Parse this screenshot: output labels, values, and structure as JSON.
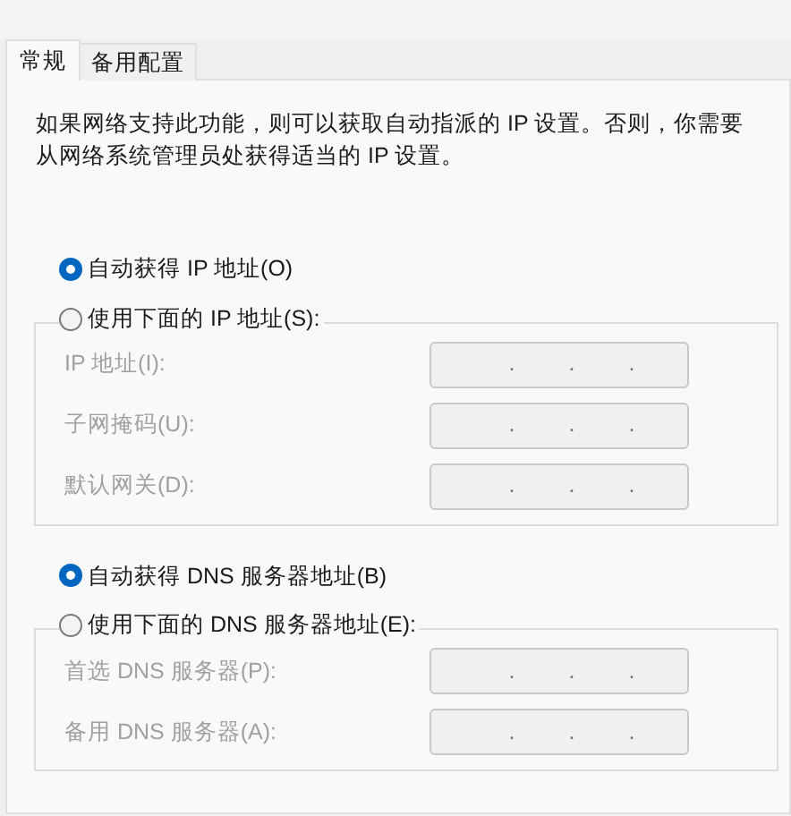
{
  "tabs": [
    {
      "label": "常规",
      "selected": true
    },
    {
      "label": "备用配置",
      "selected": false
    }
  ],
  "description": "如果网络支持此功能，则可以获取自动指派的 IP 设置。否则，你需要从网络系统管理员处获得适当的 IP 设置。",
  "sections": [
    {
      "auto_option": {
        "label": "自动获得 IP 地址(O)",
        "selected": true
      },
      "manual_option": {
        "label": "使用下面的 IP 地址(S):",
        "selected": false
      },
      "fields": [
        {
          "label": "IP 地址(I):",
          "separators": [
            ".",
            ".",
            "."
          ],
          "disabled": true
        },
        {
          "label": "子网掩码(U):",
          "separators": [
            ".",
            ".",
            "."
          ],
          "disabled": true
        },
        {
          "label": "默认网关(D):",
          "separators": [
            ".",
            ".",
            "."
          ],
          "disabled": true
        }
      ]
    },
    {
      "auto_option": {
        "label": "自动获得 DNS 服务器地址(B)",
        "selected": true
      },
      "manual_option": {
        "label": "使用下面的 DNS 服务器地址(E):",
        "selected": false
      },
      "fields": [
        {
          "label": "首选 DNS 服务器(P):",
          "separators": [
            ".",
            ".",
            "."
          ],
          "disabled": true
        },
        {
          "label": "备用 DNS 服务器(A):",
          "separators": [
            ".",
            ".",
            "."
          ],
          "disabled": true
        }
      ]
    }
  ]
}
